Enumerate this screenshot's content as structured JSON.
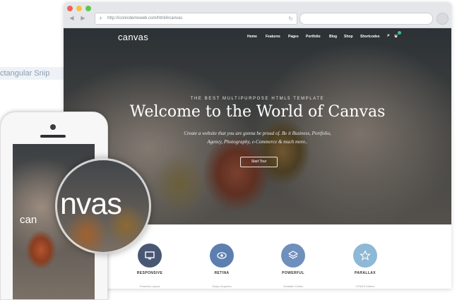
{
  "snip_label": "ctangular Snip",
  "browser": {
    "url": "http://iconicdemoweb.com/html4/canvas",
    "nav_back_icon": "back-arrow-icon",
    "nav_forward_icon": "forward-arrow-icon"
  },
  "site": {
    "logo": "canvas",
    "nav": [
      "Home",
      "Features",
      "Pages",
      "Portfolio",
      "Blog",
      "Shop",
      "Shortcodes"
    ],
    "hero": {
      "kicker": "THE BEST MULTIPURPOSE HTML5 TEMPLATE",
      "headline": "Welcome to the World of Canvas",
      "subtext_line1": "Create a website that you are gonna be proud of. Be it Business, Portfolio,",
      "subtext_line2": "Agency, Photography, e-Commerce & much more..",
      "button": "Start Tour"
    },
    "features": [
      {
        "title": "RESPONSIVE",
        "sub": "Powerful Layout",
        "icon": "monitor-icon",
        "color": "#4a5774"
      },
      {
        "title": "RETINA",
        "sub": "Sharp Graphics",
        "icon": "eye-icon",
        "color": "#5d7fb0"
      },
      {
        "title": "POWERFUL",
        "sub": "Scalable Codes",
        "icon": "layers-icon",
        "color": "#6f8fbd"
      },
      {
        "title": "PARALLAX",
        "sub": "HTML5 Videos",
        "icon": "star-icon",
        "color": "#8db8d6"
      }
    ]
  },
  "phone": {
    "logo_partial": "can",
    "magnifier_text": "nvas"
  }
}
